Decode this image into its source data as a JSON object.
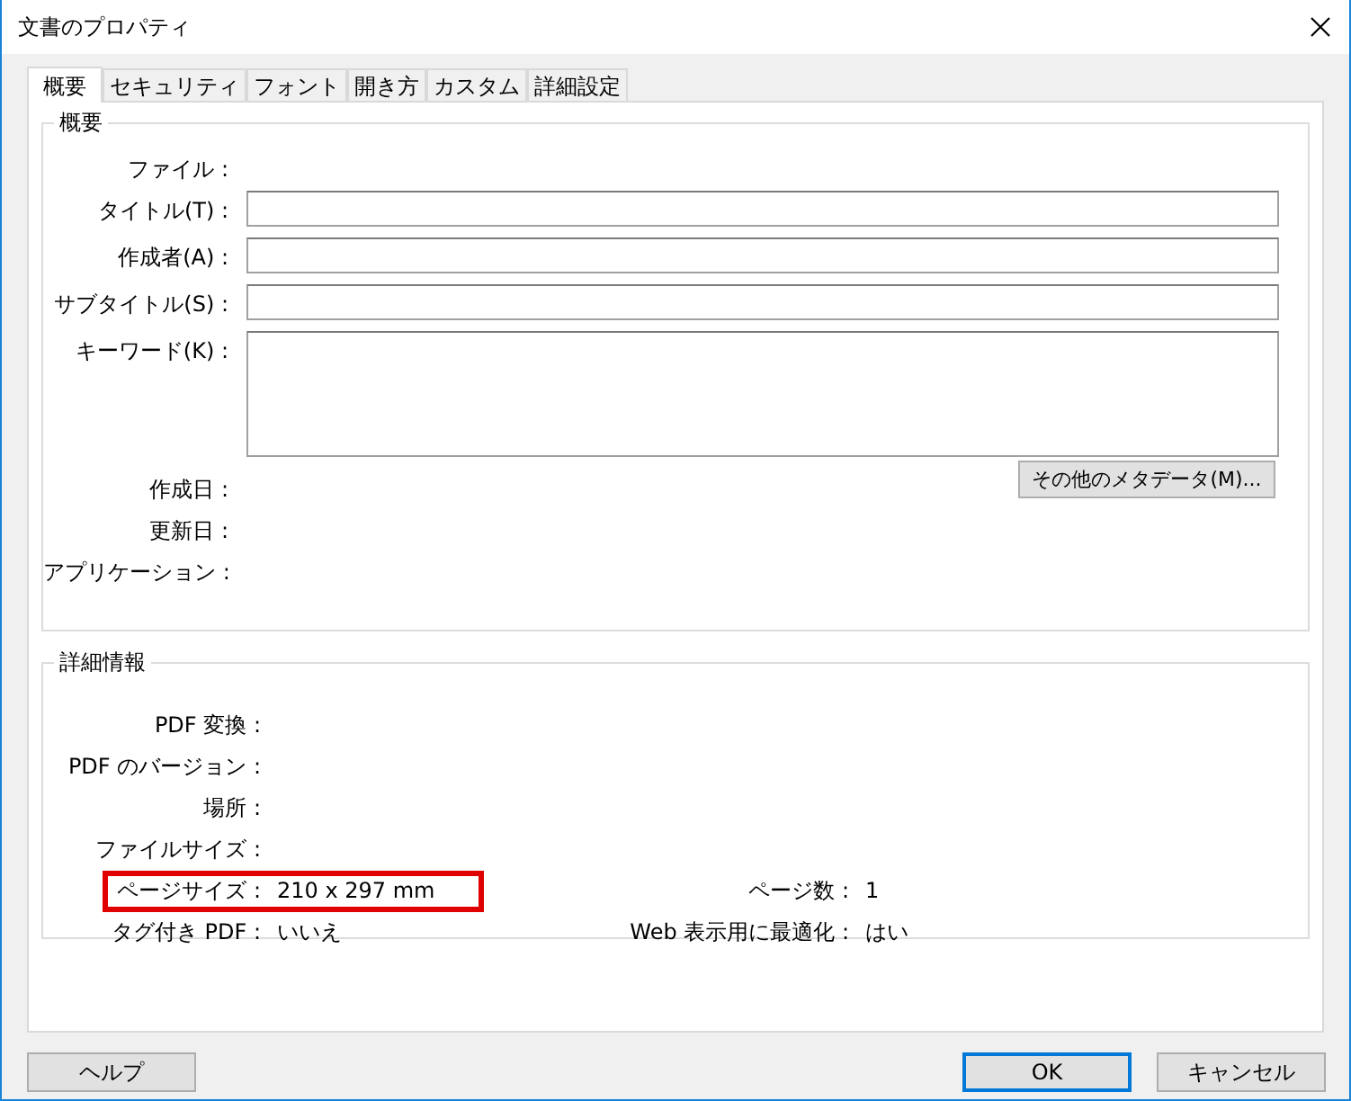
{
  "window": {
    "title": "文書のプロパティ"
  },
  "tabs": [
    {
      "label": "概要",
      "selected": true
    },
    {
      "label": "セキュリティ",
      "selected": false
    },
    {
      "label": "フォント",
      "selected": false
    },
    {
      "label": "開き方",
      "selected": false
    },
    {
      "label": "カスタム",
      "selected": false
    },
    {
      "label": "詳細設定",
      "selected": false
    }
  ],
  "summary": {
    "title": "概要",
    "rows": [
      {
        "kind": "text",
        "label": "ファイル :"
      },
      {
        "kind": "field",
        "label": "タイトル(T) :"
      },
      {
        "kind": "field",
        "label": "作成者(A) :"
      },
      {
        "kind": "field",
        "label": "サブタイトル(S) :"
      },
      {
        "kind": "area",
        "label": "キーワード(K) :"
      },
      {
        "kind": "text",
        "label": "作成日 :"
      },
      {
        "kind": "text",
        "label": "更新日 :"
      },
      {
        "kind": "text",
        "label": "アプリケーション :"
      }
    ],
    "metadata_button": "その他のメタデータ(M)..."
  },
  "details": {
    "title": "詳細情報",
    "rows": [
      {
        "label": "PDF 変換 :",
        "highlighted": false
      },
      {
        "label": "PDF のバージョン :",
        "highlighted": false
      },
      {
        "label": "場所 :",
        "highlighted": false
      },
      {
        "label": "ファイルサイズ :",
        "highlighted": false
      },
      {
        "label": "ページサイズ :",
        "value": "210 x 297 mm",
        "extra_label": "ページ数 :",
        "extra_value": "1",
        "highlighted": true
      },
      {
        "label": "タグ付き PDF :",
        "value": "いいえ",
        "extra_label": "Web 表示用に最適化 :",
        "extra_value": "はい",
        "highlighted": false
      }
    ]
  },
  "help_button": {
    "label": "ヘルプ",
    "default": false
  },
  "buttons": [
    {
      "label": "OK",
      "default": true
    },
    {
      "label": "キャンセル",
      "default": false
    }
  ]
}
